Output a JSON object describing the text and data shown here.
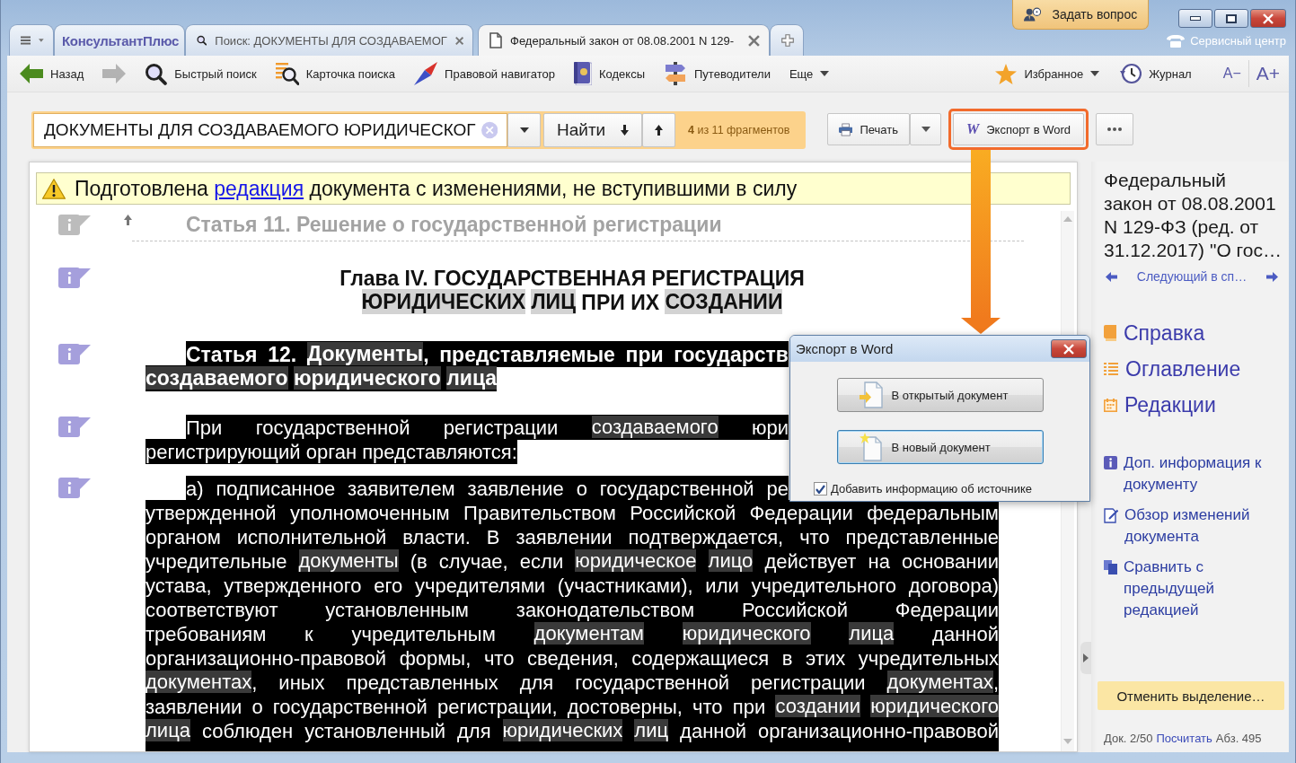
{
  "window": {
    "ask_button": "Задать вопрос",
    "service_center": "Сервисный центр"
  },
  "tabs": [
    {
      "kind": "brand",
      "label": "КонсультантПлюс",
      "selected": false
    },
    {
      "kind": "search",
      "label": "Поиск: ДОКУМЕНТЫ ДЛЯ СОЗДАВАЕМОГ",
      "selected": false
    },
    {
      "kind": "document",
      "label": "Федеральный закон от 08.08.2001 N 129-",
      "selected": true
    }
  ],
  "toolbar": {
    "left": [
      {
        "kind": "back",
        "label": "Назад",
        "disabled": false
      },
      {
        "kind": "forward",
        "disabled": true
      },
      {
        "kind": "quick-search",
        "label": "Быстрый поиск",
        "disabled": false
      },
      {
        "kind": "search-card",
        "label": "Карточка поиска",
        "disabled": false
      },
      {
        "kind": "navigator",
        "label": "Правовой навигатор",
        "disabled": false
      },
      {
        "kind": "codes",
        "label": "Кодексы",
        "disabled": false
      },
      {
        "kind": "guides",
        "label": "Путеводители",
        "disabled": false
      },
      {
        "kind": "more",
        "label": "Еще",
        "disabled": false
      }
    ],
    "right": [
      {
        "kind": "favorites",
        "label": "Избранное"
      },
      {
        "kind": "history",
        "label": "Журнал"
      },
      {
        "kind": "font-smaller",
        "label": "A−"
      },
      {
        "kind": "font-larger",
        "label": "A+"
      }
    ]
  },
  "search_bar": {
    "query": "ДОКУМЕНТЫ ДЛЯ СОЗДАВАЕМОГО ЮРИДИЧЕСКОГ",
    "find_label": "Найти",
    "fragments": "**4** из 11 фрагментов",
    "actions": [
      {
        "kind": "print",
        "label": "Печать",
        "highlighted": false
      },
      {
        "kind": "export",
        "logo": "W",
        "label": "Экспорт в Word",
        "highlighted": true
      },
      {
        "kind": "more",
        "highlighted": false
      }
    ]
  },
  "document": {
    "warning": {
      "before": "Подготовлена ",
      "link": "редакция",
      "after": " документа с изменениями, не вступившими в силу"
    },
    "blocks": [
      {
        "kind": "previous-heading",
        "text": "Статья 11. Решение о государственной регистрации"
      },
      {
        "kind": "chapter",
        "selected": false,
        "continues": false,
        "lines": [
          {
            "covered": false,
            "segments": [
              {
                "text": "Глава IV. ГОСУДАРСТВЕННАЯ РЕГИСТРАЦИЯ",
                "match": false
              }
            ]
          },
          {
            "covered": false,
            "segments": [
              {
                "text": "ЮРИДИЧЕСКИХ",
                "match": true
              },
              {
                "text": "ЛИЦ",
                "match": true
              },
              {
                "text": " ПРИ ИХ ",
                "match": false
              },
              {
                "text": "СОЗДАНИИ",
                "match": true
              }
            ]
          }
        ]
      },
      {
        "kind": "article",
        "selected": true,
        "continues": false,
        "lines": [
          {
            "covered": true,
            "segments": [
              {
                "text": "Статья 12. ",
                "match": false
              },
              {
                "text": "Документы",
                "match": true
              },
              {
                "text": ", представляемые при государств",
                "match": false
              }
            ]
          },
          {
            "covered": false,
            "segments": [
              {
                "text": "создаваемого",
                "match": true
              },
              {
                "text": "юридического",
                "match": true
              },
              {
                "text": "лица",
                "match": true
              }
            ]
          }
        ]
      },
      {
        "kind": "paragraph",
        "selected": true,
        "continues": false,
        "lines": [
          {
            "covered": true,
            "segments": [
              {
                "text": "При государственной регистрации ",
                "match": false
              },
              {
                "text": "создаваемого",
                "match": true
              },
              {
                "text": " юри",
                "match": false
              }
            ]
          },
          {
            "covered": false,
            "segments": [
              {
                "text": "регистрирующий орган представляются:",
                "match": false
              }
            ]
          }
        ]
      },
      {
        "kind": "subitem",
        "selected": true,
        "continues": true,
        "lines": [
          {
            "covered": true,
            "segments": [
              {
                "text": "а) подписанное заявителем заявление о государственной ре",
                "match": false
              }
            ]
          },
          {
            "covered": false,
            "segments": [
              {
                "text": "утвержденной уполномоченным Правительством Российской Федерации федеральным",
                "match": false
              }
            ]
          },
          {
            "covered": false,
            "segments": [
              {
                "text": "органом исполнительной власти. В заявлении подтверждается, что представленные",
                "match": false
              }
            ]
          },
          {
            "covered": false,
            "segments": [
              {
                "text": "учредительные ",
                "match": false
              },
              {
                "text": "документы",
                "match": true
              },
              {
                "text": " (в случае, если ",
                "match": false
              },
              {
                "text": "юридическое",
                "match": true
              },
              {
                "text": "лицо",
                "match": true
              },
              {
                "text": " действует на основании",
                "match": false
              }
            ]
          },
          {
            "covered": false,
            "segments": [
              {
                "text": "устава, утвержденного его учредителями (участниками), или учредительного договора)",
                "match": false
              }
            ]
          },
          {
            "covered": false,
            "segments": [
              {
                "text": "соответствуют установленным законодательством Российской Федерации",
                "match": false
              }
            ]
          },
          {
            "covered": false,
            "segments": [
              {
                "text": "требованиям к учредительным ",
                "match": false
              },
              {
                "text": "документам",
                "match": true
              },
              {
                "text": "юридического",
                "match": true
              },
              {
                "text": "лица",
                "match": true
              },
              {
                "text": " данной",
                "match": false
              }
            ]
          },
          {
            "covered": false,
            "segments": [
              {
                "text": "организационно-правовой формы, что сведения, содержащиеся в этих учредительных",
                "match": false
              }
            ]
          },
          {
            "covered": false,
            "segments": [
              {
                "text": "документах",
                "match": true
              },
              {
                "text": ", иных представленных для государственной регистрации ",
                "match": false
              },
              {
                "text": "документах",
                "match": true
              },
              {
                "text": ",",
                "match": false
              }
            ]
          },
          {
            "covered": false,
            "segments": [
              {
                "text": "заявлении о государственной регистрации, достоверны, что при ",
                "match": false
              },
              {
                "text": "создании",
                "match": true
              },
              {
                "text": "юридического",
                "match": true
              }
            ]
          },
          {
            "covered": false,
            "segments": [
              {
                "text": "лица",
                "match": true
              },
              {
                "text": " соблюден установленный для ",
                "match": false
              },
              {
                "text": "юридических",
                "match": true
              },
              {
                "text": "лиц",
                "match": true
              },
              {
                "text": " данной организационно-правовой",
                "match": false
              }
            ]
          }
        ]
      }
    ]
  },
  "dialog": {
    "title": "Экспорт в Word",
    "buttons": [
      {
        "kind": "open-document",
        "label": "В открытый документ",
        "focused": false
      },
      {
        "kind": "new-document",
        "label": "В новый документ",
        "focused": true
      }
    ],
    "checkbox": {
      "label": "Добавить информацию об источнике",
      "checked": true
    }
  },
  "sidebar": {
    "title": "Федеральный\nзакон от 08.08.2001\nN 129-ФЗ (ред. от\n31.12.2017) \"О гос…",
    "next": "Следующий в сп…",
    "sections": [
      {
        "kind": "reference",
        "label": "Справка"
      },
      {
        "kind": "contents",
        "label": "Оглавление"
      },
      {
        "kind": "editions",
        "label": "Редакции"
      }
    ],
    "links": [
      {
        "kind": "info",
        "label": "Доп. информация к документу"
      },
      {
        "kind": "changes",
        "label": "Обзор изменений документа"
      },
      {
        "kind": "compare",
        "label": "Сравнить с предыдущей редакцией"
      }
    ],
    "clear_button": "Отменить выделение…",
    "status": {
      "position": "Док. 2/50",
      "count_link": "Посчитать",
      "paragraph": "Абз. 495"
    }
  }
}
